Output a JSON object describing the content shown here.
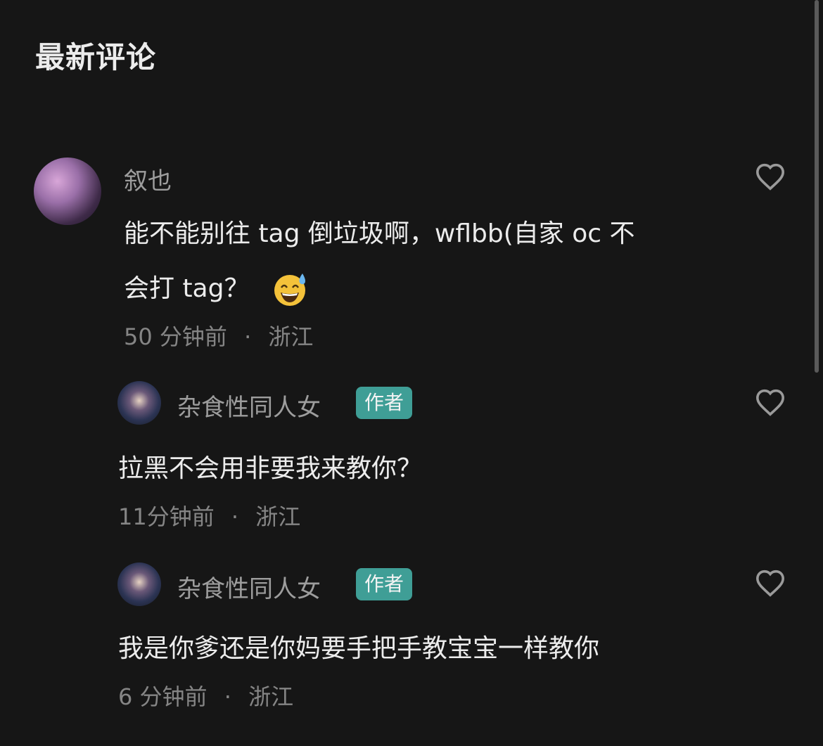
{
  "section_title": "最新评论",
  "comments": [
    {
      "username": "叙也",
      "text_line1": "能不能别往 tag 倒垃圾啊，wflbb(自家 oc 不",
      "text_line2": "会打 tag？",
      "emoji": "sweat-smile-emoji",
      "time": "50 分钟前",
      "location": "浙江"
    },
    {
      "username": "杂食性同人女",
      "badge": "作者",
      "text": "拉黑不会用非要我来教你？",
      "time": "11分钟前",
      "location": "浙江"
    },
    {
      "username": "杂食性同人女",
      "badge": "作者",
      "text": "我是你爹还是你妈要手把手教宝宝一样教你",
      "time": "6 分钟前",
      "location": "浙江"
    }
  ],
  "separator": "·",
  "colors": {
    "background": "#161616",
    "badge": "#3f9e96"
  },
  "icons": {
    "like": "heart-outline-icon"
  }
}
